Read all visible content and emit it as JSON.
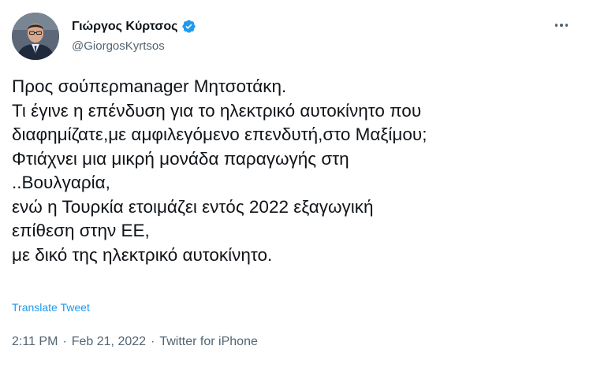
{
  "author": {
    "display_name": "Γιώργος Κύρτσος",
    "handle": "@GiorgosKyrtsos",
    "verified": true,
    "avatar_icon": "avatar"
  },
  "menu": {
    "icon": "more-horizontal-icon"
  },
  "tweet": {
    "lines": [
      "Προς σούπερmanager Μητσοτάκη.",
      "Τι έγινε η επένδυση για το ηλεκτρικό αυτοκίνητο που",
      "διαφημίζατε,με αμφιλεγόμενο επενδυτή,στο Μαξίμου;",
      "Φτιάχνει μια μικρή μονάδα παραγωγής στη",
      "..Βουλγαρία,",
      "ενώ η Τουρκία ετοιμάζει εντός 2022 εξαγωγική",
      "επίθεση στην ΕΕ,",
      "με δικό της ηλεκτρικό αυτοκίνητο."
    ],
    "translate_label": "Translate Tweet"
  },
  "meta": {
    "time": "2:11 PM",
    "separator": "·",
    "date": "Feb 21, 2022",
    "source": "Twitter for iPhone"
  },
  "colors": {
    "text": "#0f1419",
    "secondary": "#536471",
    "accent": "#1d9bf0"
  }
}
